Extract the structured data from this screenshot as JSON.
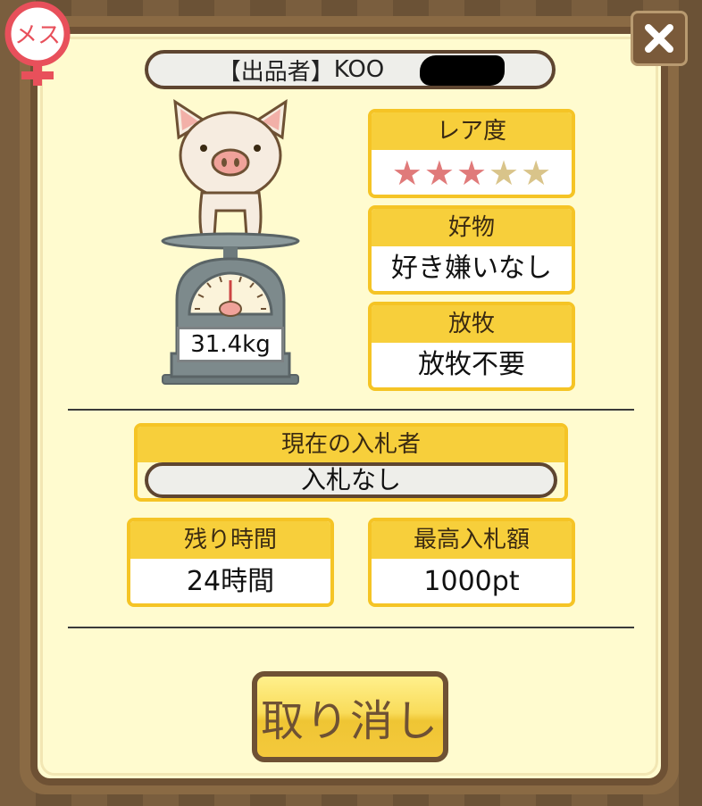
{
  "gender_badge": {
    "text": "メス",
    "icon": "female-symbol-icon",
    "color": "#e8505b"
  },
  "close_button": {
    "icon": "close-icon"
  },
  "seller": {
    "prefix": "【出品者】",
    "name": "KOO"
  },
  "pig": {
    "weight": "31.4kg"
  },
  "rarity": {
    "label": "レア度",
    "value": 3,
    "max": 5,
    "filled_color": "#e07a7a",
    "empty_color": "#d9c48a"
  },
  "favorite": {
    "label": "好物",
    "value": "好き嫌いなし"
  },
  "pasture": {
    "label": "放牧",
    "value": "放牧不要"
  },
  "current_bidder": {
    "label": "現在の入札者",
    "value": "入札なし"
  },
  "time_left": {
    "label": "残り時間",
    "value": "24時間"
  },
  "max_bid": {
    "label": "最高入札額",
    "value": "1000pt"
  },
  "cancel_button": {
    "label": "取り消し"
  },
  "colors": {
    "header_yellow": "#f7cf3b",
    "border_brown": "#6e5134",
    "panel_bg": "#fffbcf"
  }
}
